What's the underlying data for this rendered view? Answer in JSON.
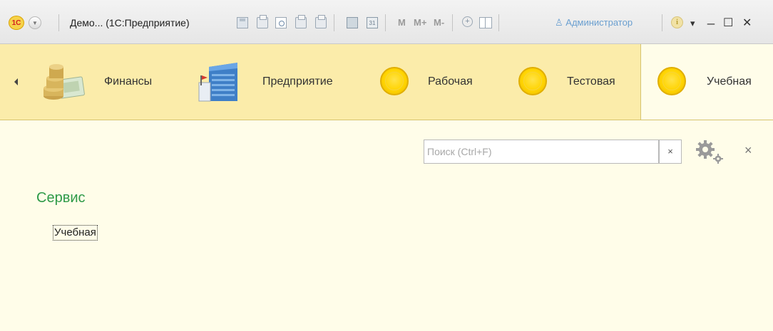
{
  "titlebar": {
    "logo_text": "1С",
    "app_title": "Демо...  (1С:Предприятие)",
    "m_label": "M",
    "m_plus_label": "M+",
    "m_minus_label": "M-",
    "calendar_text": "31",
    "user_name": "Администратор",
    "info_text": "i",
    "minimize_label": "_",
    "maximize_label": "☐",
    "close_label": "✕"
  },
  "sections": {
    "items": [
      {
        "label": "Финансы",
        "icon": "coins-icon"
      },
      {
        "label": "Предприятие",
        "icon": "building-icon"
      },
      {
        "label": "Рабочая",
        "icon": "yellow-circle-icon"
      },
      {
        "label": "Тестовая",
        "icon": "yellow-circle-icon"
      },
      {
        "label": "Учебная",
        "icon": "yellow-circle-icon",
        "active": true
      }
    ],
    "background_color": "#fbecaa",
    "active_background": "#fffde9"
  },
  "main": {
    "search_placeholder": "Поиск (Ctrl+F)",
    "search_value": "",
    "search_clear_label": "×",
    "close_label": "×",
    "group_title": "Сервис",
    "group_items": [
      "Учебная"
    ],
    "group_title_color": "#2e9a48"
  }
}
